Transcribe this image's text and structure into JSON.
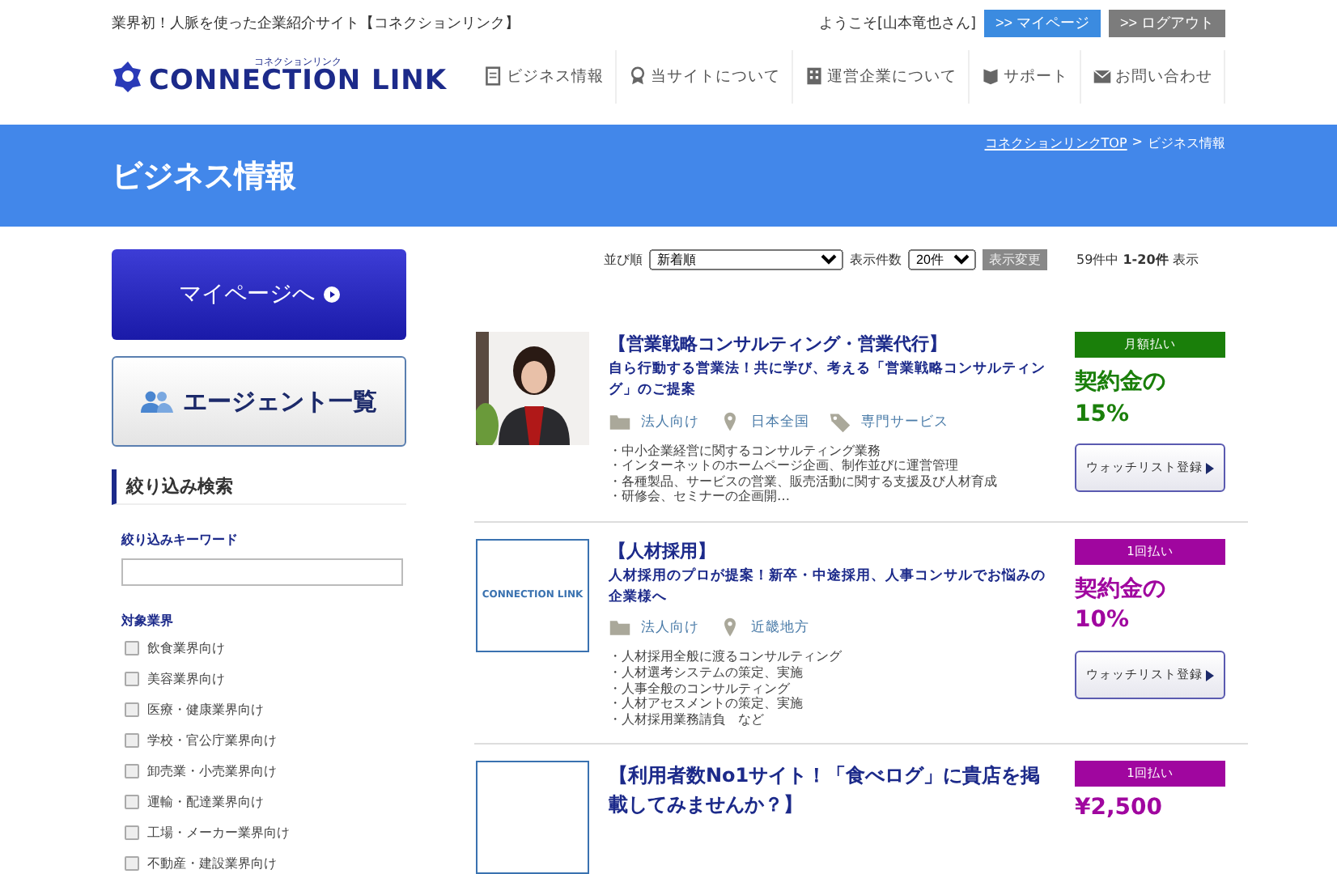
{
  "header": {
    "tagline": "業界初！人脈を使った企業紹介サイト【コネクションリンク】",
    "welcome": "ようこそ[山本竜也さん]",
    "mypage_button": ">> マイページ",
    "logout_button": ">> ログアウト",
    "logo": {
      "ruby": "コネクションリンク",
      "text": "CONNECTION LINK"
    },
    "nav": [
      {
        "kind": "document",
        "label": "ビジネス情報"
      },
      {
        "kind": "award",
        "label": "当サイトについて"
      },
      {
        "kind": "building",
        "label": "運営企業について"
      },
      {
        "kind": "book",
        "label": "サポート"
      },
      {
        "kind": "mail",
        "label": "お問い合わせ"
      }
    ]
  },
  "banner": {
    "title": "ビジネス情報",
    "breadcrumb_link": "コネクションリンクTOP",
    "breadcrumb_sep": ">",
    "breadcrumb_current": "ビジネス情報"
  },
  "sidebar": {
    "mypage_button": "マイページへ",
    "agents_button": "エージェント一覧",
    "filter_heading": "絞り込み検索",
    "keyword_label": "絞り込みキーワード",
    "industry_label": "対象業界",
    "industries": [
      {
        "label": "飲食業界向け",
        "checked": false
      },
      {
        "label": "美容業界向け",
        "checked": false
      },
      {
        "label": "医療・健康業界向け",
        "checked": false
      },
      {
        "label": "学校・官公庁業界向け",
        "checked": false
      },
      {
        "label": "卸売業・小売業界向け",
        "checked": false
      },
      {
        "label": "運輸・配達業界向け",
        "checked": false
      },
      {
        "label": "工場・メーカー業界向け",
        "checked": false
      },
      {
        "label": "不動産・建設業界向け",
        "checked": false
      }
    ]
  },
  "toolbar": {
    "sort_label": "並び順",
    "sort_value": "新着順",
    "count_label": "表示件数",
    "count_value": "20件",
    "apply_button": "表示変更",
    "total": "59件中",
    "range": "1-20件",
    "shown": "表示"
  },
  "listings": [
    {
      "title": "【営業戦略コンサルティング・営業代行】",
      "subtitle": "自ら行動する営業法！共に学び、考える「営業戦略コンサルティング」のご提案",
      "tags": [
        {
          "kind": "category",
          "label": "法人向け"
        },
        {
          "kind": "area",
          "label": "日本全国"
        },
        {
          "kind": "service",
          "label": "専門サービス"
        }
      ],
      "details": [
        "・中小企業経営に関するコンサルティング業務",
        "・インターネットのホームページ企画、制作並びに運営管理",
        "・各種製品、サービスの営業、販売活動に関する支援及び人材育成",
        "・研修会、セミナーの企画開…"
      ],
      "payment": "月額払い",
      "color": "#1a7f0a",
      "price": "契約金の15%",
      "watch_button": "ウォッチリスト登録"
    },
    {
      "kind": "logo",
      "logo_text": "CONNECTION LINK",
      "title": "【人材採用】",
      "subtitle": "人材採用のプロが提案！新卒・中途採用、人事コンサルでお悩みの企業様へ",
      "tags": [
        {
          "kind": "category",
          "label": "法人向け"
        },
        {
          "kind": "area",
          "label": "近畿地方"
        }
      ],
      "details": [
        "・人材採用全般に渡るコンサルティング",
        "・人材選考システムの策定、実施",
        "・人事全般のコンサルティング",
        "・人材アセスメントの策定、実施",
        "・人材採用業務請負　など"
      ],
      "payment": "1回払い",
      "color": "#a0069f",
      "price": "契約金の10%",
      "watch_button": "ウォッチリスト登録"
    },
    {
      "kind": "logo",
      "title": "【利用者数No1サイト！「食べログ」に貴店を掲載してみませんか？】",
      "payment": "1回払い",
      "color": "#a0069f",
      "price": "¥2,500"
    }
  ]
}
